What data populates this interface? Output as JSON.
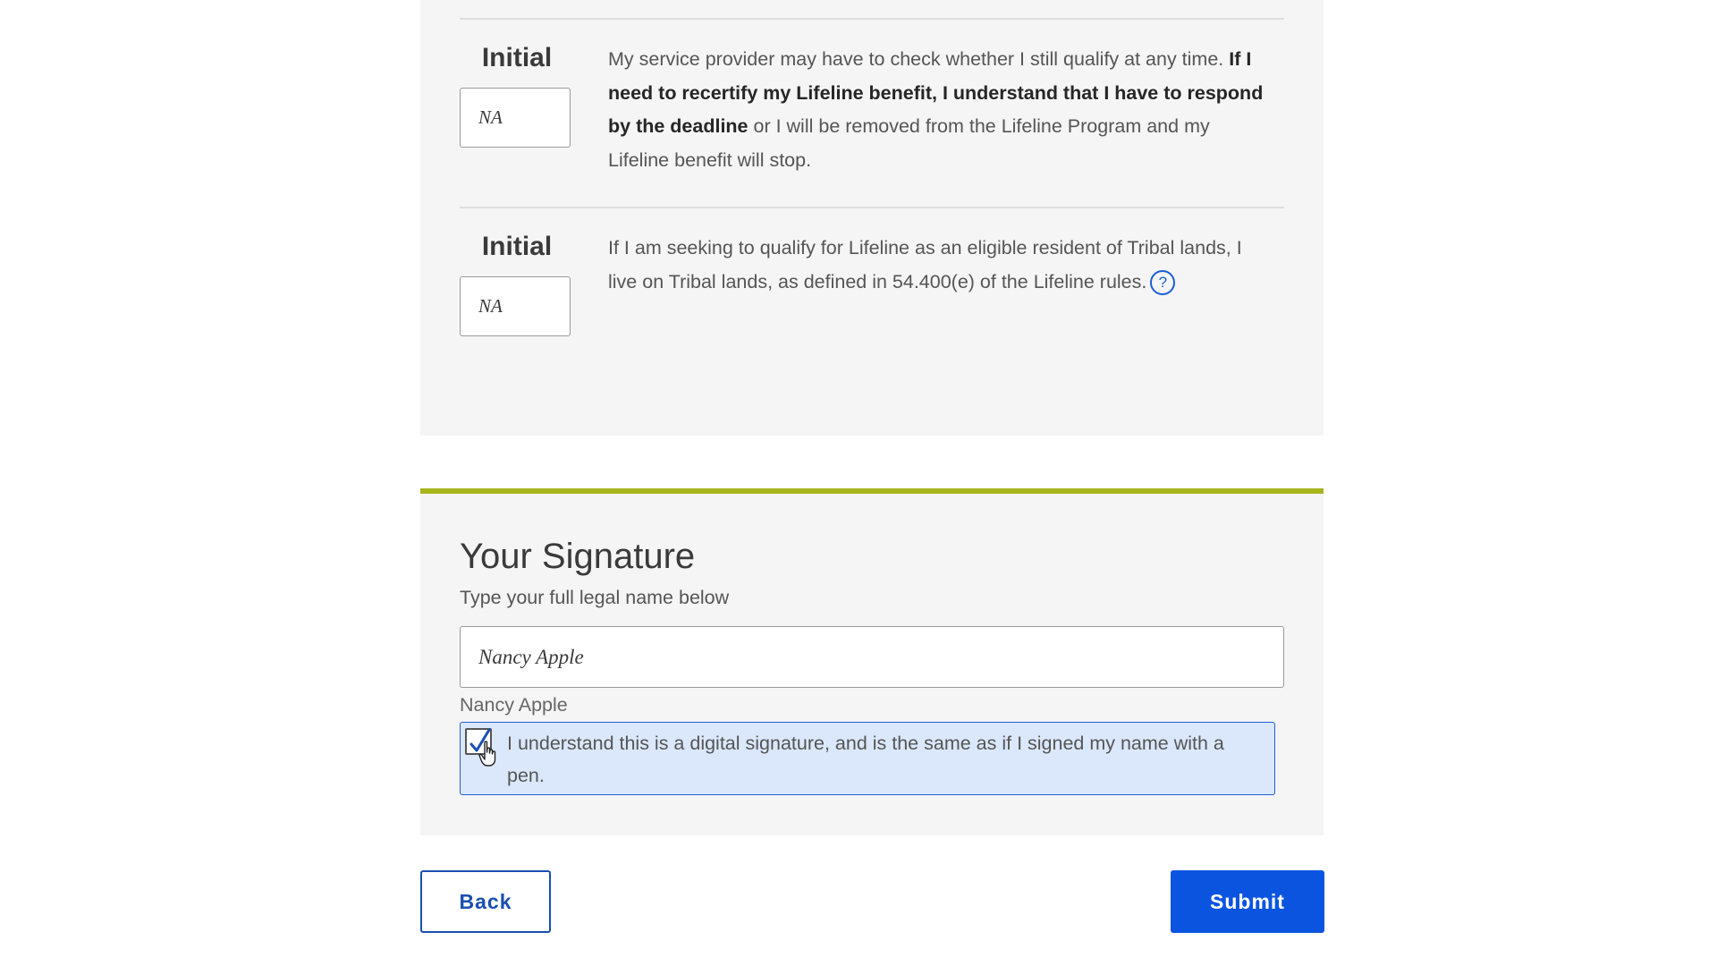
{
  "certifications": [
    {
      "initial_label": "Initial",
      "initial_value": "NA",
      "text_plain_1": "My service provider may have to check whether I still qualify at any time. ",
      "text_bold": "If I need to recertify my Lifeline benefit, I understand that I have to respond by the deadline",
      "text_plain_2": " or I will be removed from the Lifeline Program and my Lifeline benefit will stop."
    },
    {
      "initial_label": "Initial",
      "initial_value": "NA",
      "text_plain_1": "If I am seeking to qualify for Lifeline as an eligible resident of Tribal lands, I live on Tribal lands, as defined in 54.400(e) of the Lifeline rules.",
      "help_glyph": "?",
      "help_icon": "question-circle-icon"
    }
  ],
  "signature": {
    "title": "Your Signature",
    "subtitle": "Type your full legal name below",
    "name_value": "Nancy Apple",
    "name_echo": "Nancy Apple",
    "ack_checked": true,
    "ack_text": "I understand this is a digital signature, and is the same as if I signed my name with a pen."
  },
  "buttons": {
    "back_label": "Back",
    "submit_label": "Submit"
  },
  "colors": {
    "accent_rule": "#a6b51c",
    "primary": "#0a54e0",
    "ack_bg": "#dbe8fb"
  }
}
